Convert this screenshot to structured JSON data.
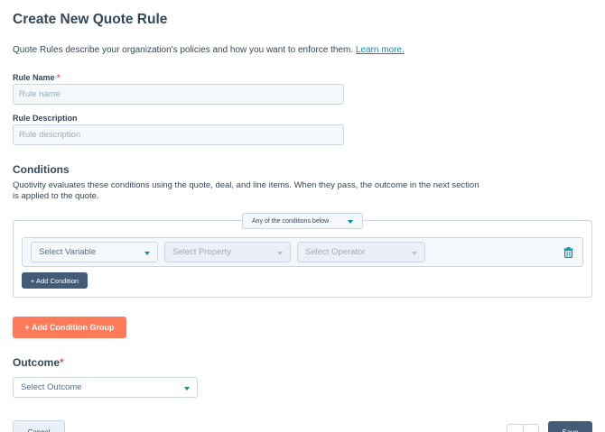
{
  "page": {
    "title": "Create New Quote Rule",
    "intro": "Quote Rules describe your organization's policies and how you want to enforce them.",
    "learn_more": "Learn more."
  },
  "form": {
    "rule_name_label": "Rule Name",
    "required_marker": "*",
    "rule_name_placeholder": "Rule name",
    "rule_description_label": "Rule Description",
    "rule_description_placeholder": "Rule description"
  },
  "conditions": {
    "title": "Conditions",
    "description": "Quotivity evaluates these conditions using the quote, deal, and line items. When they pass, the outcome in the next section is applied to the quote.",
    "logic_select": "Any of the conditions below",
    "variable_placeholder": "Select Variable",
    "property_placeholder": "Select Property",
    "operator_placeholder": "Select Operator",
    "add_condition": "+ Add Condition",
    "add_condition_group": "+ Add Condition Group"
  },
  "outcome": {
    "title": "Outcome",
    "required_marker": "*",
    "placeholder": "Select Outcome"
  },
  "footer": {
    "cancel": "Cancel",
    "save": "Save"
  },
  "colors": {
    "accent_orange": "#ff7a59",
    "dark_button": "#425b76",
    "link": "#0091ae",
    "required": "#f2545b"
  },
  "icons": {
    "trash": "trash-icon",
    "caret": "chevron-down-icon"
  }
}
